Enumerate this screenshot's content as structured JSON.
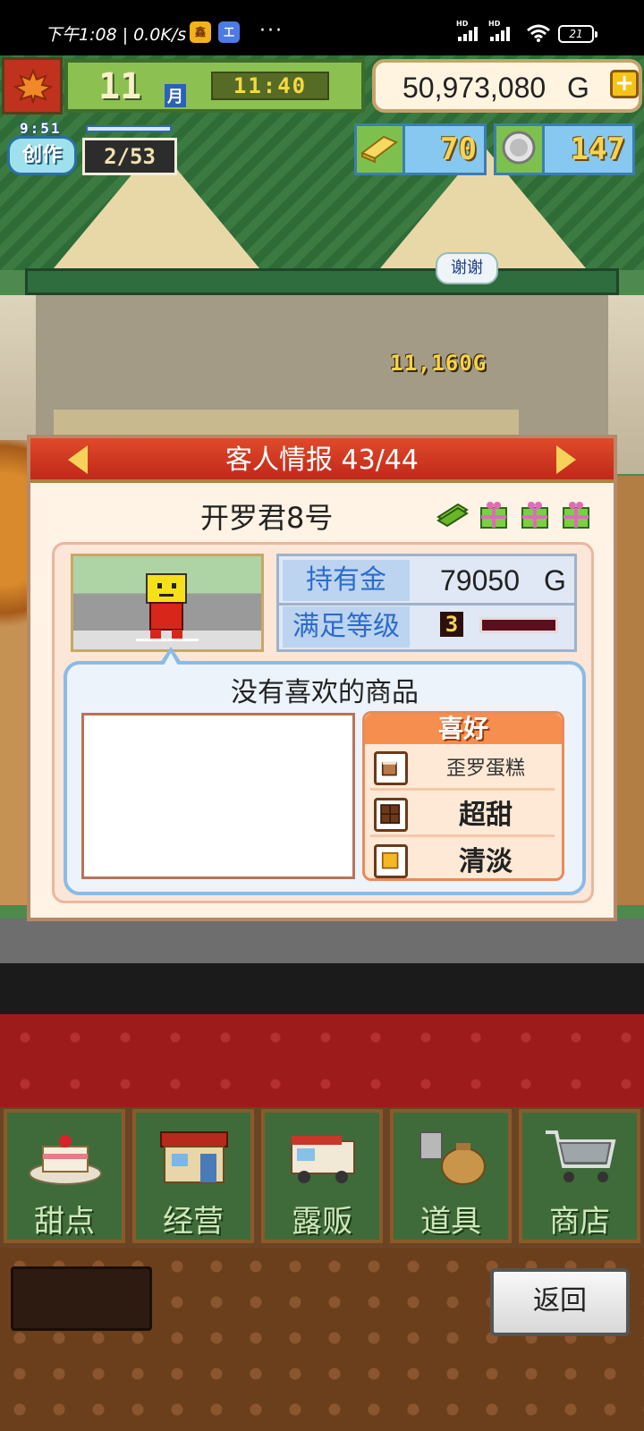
{
  "status_bar": {
    "time_text": "下午1:08 | 0.0K/s",
    "badge_1": "鑫",
    "badge_2": "工",
    "more": "···",
    "battery": "21"
  },
  "hud": {
    "month": "11",
    "month_unit": "月",
    "clock": "11:40",
    "money_value": "50,973,080",
    "money_unit": "G",
    "add_label": "+",
    "create_timer": "9:51",
    "create_label": "创作",
    "create_count": "2/53",
    "gold_bars": "70",
    "silver_medals": "147"
  },
  "scene": {
    "thanks_bubble": "谢谢",
    "floating_gold": "11,160G"
  },
  "customer_panel": {
    "title": "客人情报 43/44",
    "customer_name": "开罗君8号",
    "gold_label": "持有金",
    "gold_value": "79050",
    "gold_unit": "G",
    "satisfaction_label": "满足等级",
    "satisfaction_level": "3",
    "favorites_title": "没有喜欢的商品",
    "preferences_title": "喜好",
    "preferences": [
      {
        "icon": "cake-icon",
        "label": "歪罗蛋糕"
      },
      {
        "icon": "chocolate-icon",
        "label": "超甜"
      },
      {
        "icon": "light-cube-icon",
        "label": "清淡"
      }
    ]
  },
  "menu": {
    "items": [
      {
        "label": "甜点",
        "icon": "cake-icon"
      },
      {
        "label": "经营",
        "icon": "shop-building-icon"
      },
      {
        "label": "露贩",
        "icon": "food-truck-icon"
      },
      {
        "label": "道具",
        "icon": "tools-bag-icon"
      },
      {
        "label": "商店",
        "icon": "cart-icon"
      }
    ],
    "back_label": "返回"
  },
  "colors": {
    "panel_red": "#c0281a",
    "menu_green": "#3f6b3a",
    "stat_blue": "#2c6ccc"
  }
}
